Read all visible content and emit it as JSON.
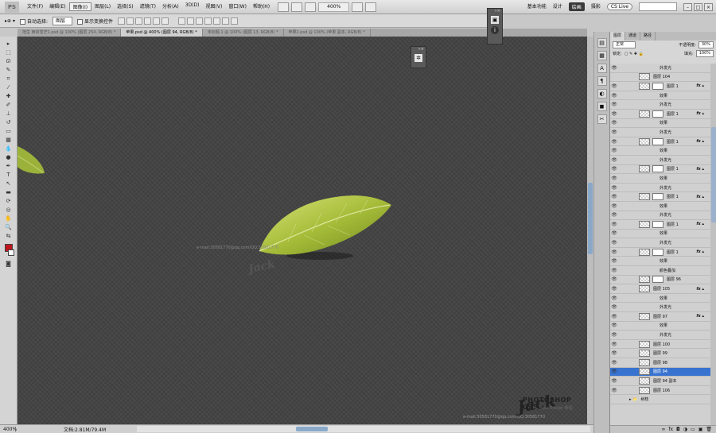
{
  "app": {
    "logo": "PS"
  },
  "menu": [
    "文件(F)",
    "编辑(E)",
    "图像(I)",
    "图层(L)",
    "选择(S)",
    "滤镜(T)",
    "分析(A)",
    "3D(D)",
    "视图(V)",
    "窗口(W)",
    "帮助(H)"
  ],
  "menu_active_index": 2,
  "menubar": {
    "zoom": "400%"
  },
  "workspaces": [
    "基本功能",
    "设计",
    "绘画",
    "摄影"
  ],
  "workspace_active_index": 2,
  "cslive": "CS Live",
  "options": {
    "auto_select_label": "自动选择:",
    "auto_select_value": "图层",
    "show_transform_label": "显示变换控件"
  },
  "tabs": [
    "地生 西京苍茫1.psd @ 100% (图层 254, RGB/8) *",
    "苹果.psd @ 400% (图层 94, RGB/8) *",
    "未标题-1 @ 100% (图层 13, RGB/8) *",
    "苹果2.psd @ 100% (苹果 副本, RGB/8) *"
  ],
  "tab_active_index": 1,
  "status": {
    "zoom": "400%",
    "doc": "文档:2.81M/79.4M"
  },
  "canvas": {
    "watermark_center": "e-mail:30581770@qq.com/QQ:30581770",
    "signature_center": "Jack",
    "brand": "PHOTOSHOP CS5",
    "brand_sub": "Huayou Design 教程",
    "watermark_bottom": "e-mail:30581770@qq.com/QQ:30581770",
    "signature_bottom": "Jack"
  },
  "layers_panel": {
    "tabs": [
      "图层",
      "通道",
      "路径"
    ],
    "blend_mode": "正常",
    "opacity_label": "不透明度:",
    "opacity": "30%",
    "lock_label": "锁定:",
    "fill_label": "填充:",
    "fill": "100%",
    "rows": [
      {
        "type": "effect",
        "name": "外发光",
        "eye": true
      },
      {
        "type": "layer",
        "name": "图层 104",
        "eye": false,
        "mask": false,
        "fx": false
      },
      {
        "type": "layer",
        "name": "图层 1",
        "eye": true,
        "mask": true,
        "fx": true
      },
      {
        "type": "effect",
        "name": "效果",
        "eye": true
      },
      {
        "type": "effect",
        "name": "外发光",
        "eye": true
      },
      {
        "type": "layer",
        "name": "图层 1",
        "eye": true,
        "mask": true,
        "fx": true
      },
      {
        "type": "effect",
        "name": "效果",
        "eye": true
      },
      {
        "type": "effect",
        "name": "外发光",
        "eye": true
      },
      {
        "type": "layer",
        "name": "图层 1",
        "eye": true,
        "mask": true,
        "fx": true
      },
      {
        "type": "effect",
        "name": "效果",
        "eye": true
      },
      {
        "type": "effect",
        "name": "外发光",
        "eye": true
      },
      {
        "type": "layer",
        "name": "图层 1",
        "eye": true,
        "mask": true,
        "fx": true
      },
      {
        "type": "effect",
        "name": "效果",
        "eye": true
      },
      {
        "type": "effect",
        "name": "外发光",
        "eye": true
      },
      {
        "type": "layer",
        "name": "图层 1",
        "eye": true,
        "mask": true,
        "fx": true
      },
      {
        "type": "effect",
        "name": "效果",
        "eye": true
      },
      {
        "type": "effect",
        "name": "外发光",
        "eye": true
      },
      {
        "type": "layer",
        "name": "图层 1",
        "eye": true,
        "mask": true,
        "fx": true
      },
      {
        "type": "effect",
        "name": "效果",
        "eye": true
      },
      {
        "type": "effect",
        "name": "外发光",
        "eye": true
      },
      {
        "type": "layer",
        "name": "图层 1",
        "eye": true,
        "mask": true,
        "fx": true
      },
      {
        "type": "effect",
        "name": "效果",
        "eye": true
      },
      {
        "type": "effect",
        "name": "颜色叠加",
        "eye": true
      },
      {
        "type": "layer",
        "name": "图层 96",
        "eye": true,
        "mask": true,
        "fx": false
      },
      {
        "type": "layer",
        "name": "图层 105",
        "eye": true,
        "mask": false,
        "fx": true
      },
      {
        "type": "effect",
        "name": "效果",
        "eye": true
      },
      {
        "type": "effect",
        "name": "外发光",
        "eye": true
      },
      {
        "type": "layer",
        "name": "图层 97",
        "eye": true,
        "mask": false,
        "fx": true
      },
      {
        "type": "effect",
        "name": "效果",
        "eye": true
      },
      {
        "type": "effect",
        "name": "外发光",
        "eye": true
      },
      {
        "type": "layer",
        "name": "图层 100",
        "eye": true,
        "mask": false,
        "fx": false
      },
      {
        "type": "layer",
        "name": "图层 99",
        "eye": true,
        "mask": false,
        "fx": false
      },
      {
        "type": "layer",
        "name": "图层 98",
        "eye": true,
        "mask": false,
        "fx": false
      },
      {
        "type": "layer",
        "name": "图层 94",
        "eye": true,
        "mask": false,
        "fx": false,
        "selected": true
      },
      {
        "type": "layer",
        "name": "图层 94 副本",
        "eye": true,
        "mask": false,
        "fx": false
      },
      {
        "type": "layer",
        "name": "图层 106",
        "eye": true,
        "mask": false,
        "fx": false
      },
      {
        "type": "group",
        "name": "树枝",
        "eye": false
      }
    ]
  }
}
